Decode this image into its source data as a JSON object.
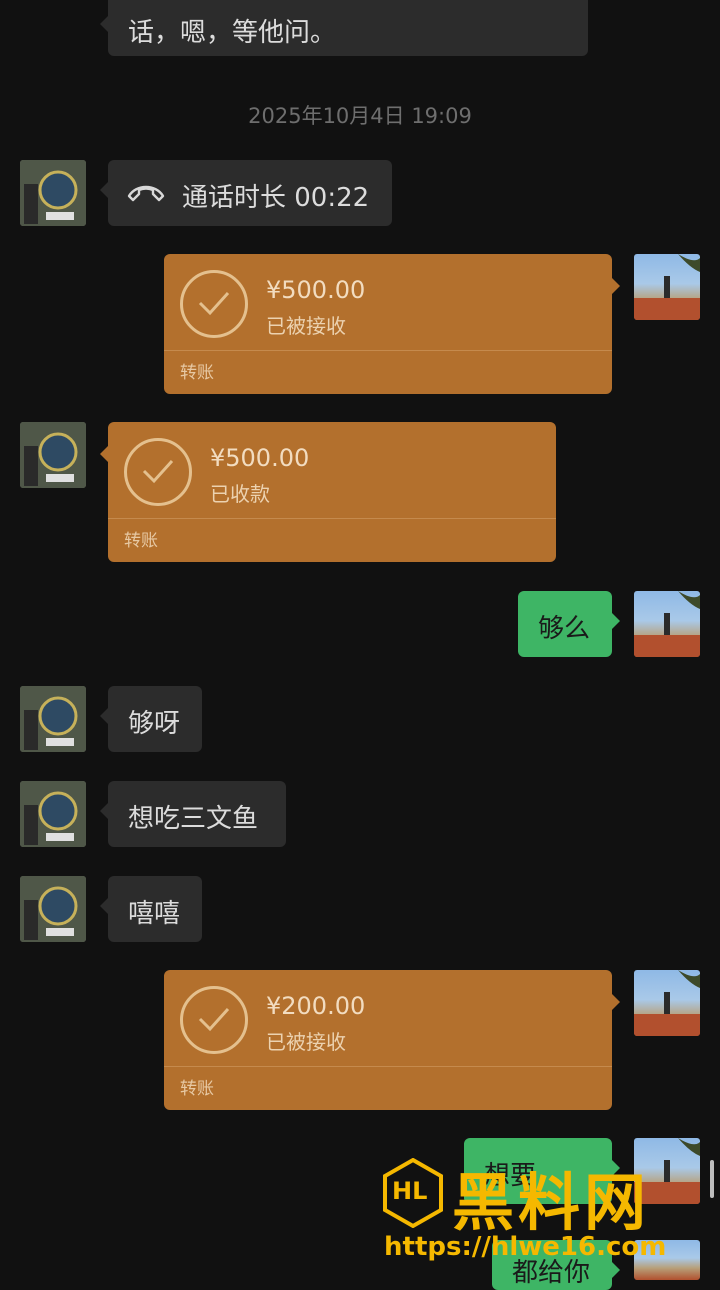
{
  "top_message": {
    "text": "话，嗯，等他问。"
  },
  "timestamp": "2025年10月4日 19:09",
  "call": {
    "icon": "phone-hangup-icon",
    "label": "通话时长 00:22"
  },
  "transfers": [
    {
      "amount": "¥500.00",
      "status": "已被接收",
      "label": "转账"
    },
    {
      "amount": "¥500.00",
      "status": "已收款",
      "label": "转账"
    },
    {
      "amount": "¥200.00",
      "status": "已被接收",
      "label": "转账"
    }
  ],
  "messages": {
    "enough_q": "够么",
    "enough_a": "够呀",
    "salmon": "想吃三文鱼",
    "hehe": "嘻嘻",
    "bottom_partial_1": "想要",
    "bottom_partial_2": "都给你"
  },
  "watermark": {
    "logo": "HL",
    "title": "黑料网",
    "url": "https://hlwe16.com"
  },
  "colors": {
    "background": "#111111",
    "incoming_bubble": "#2c2c2c",
    "outgoing_bubble": "#3eb565",
    "transfer_card": "#b3702d",
    "watermark": "#f5b800"
  }
}
